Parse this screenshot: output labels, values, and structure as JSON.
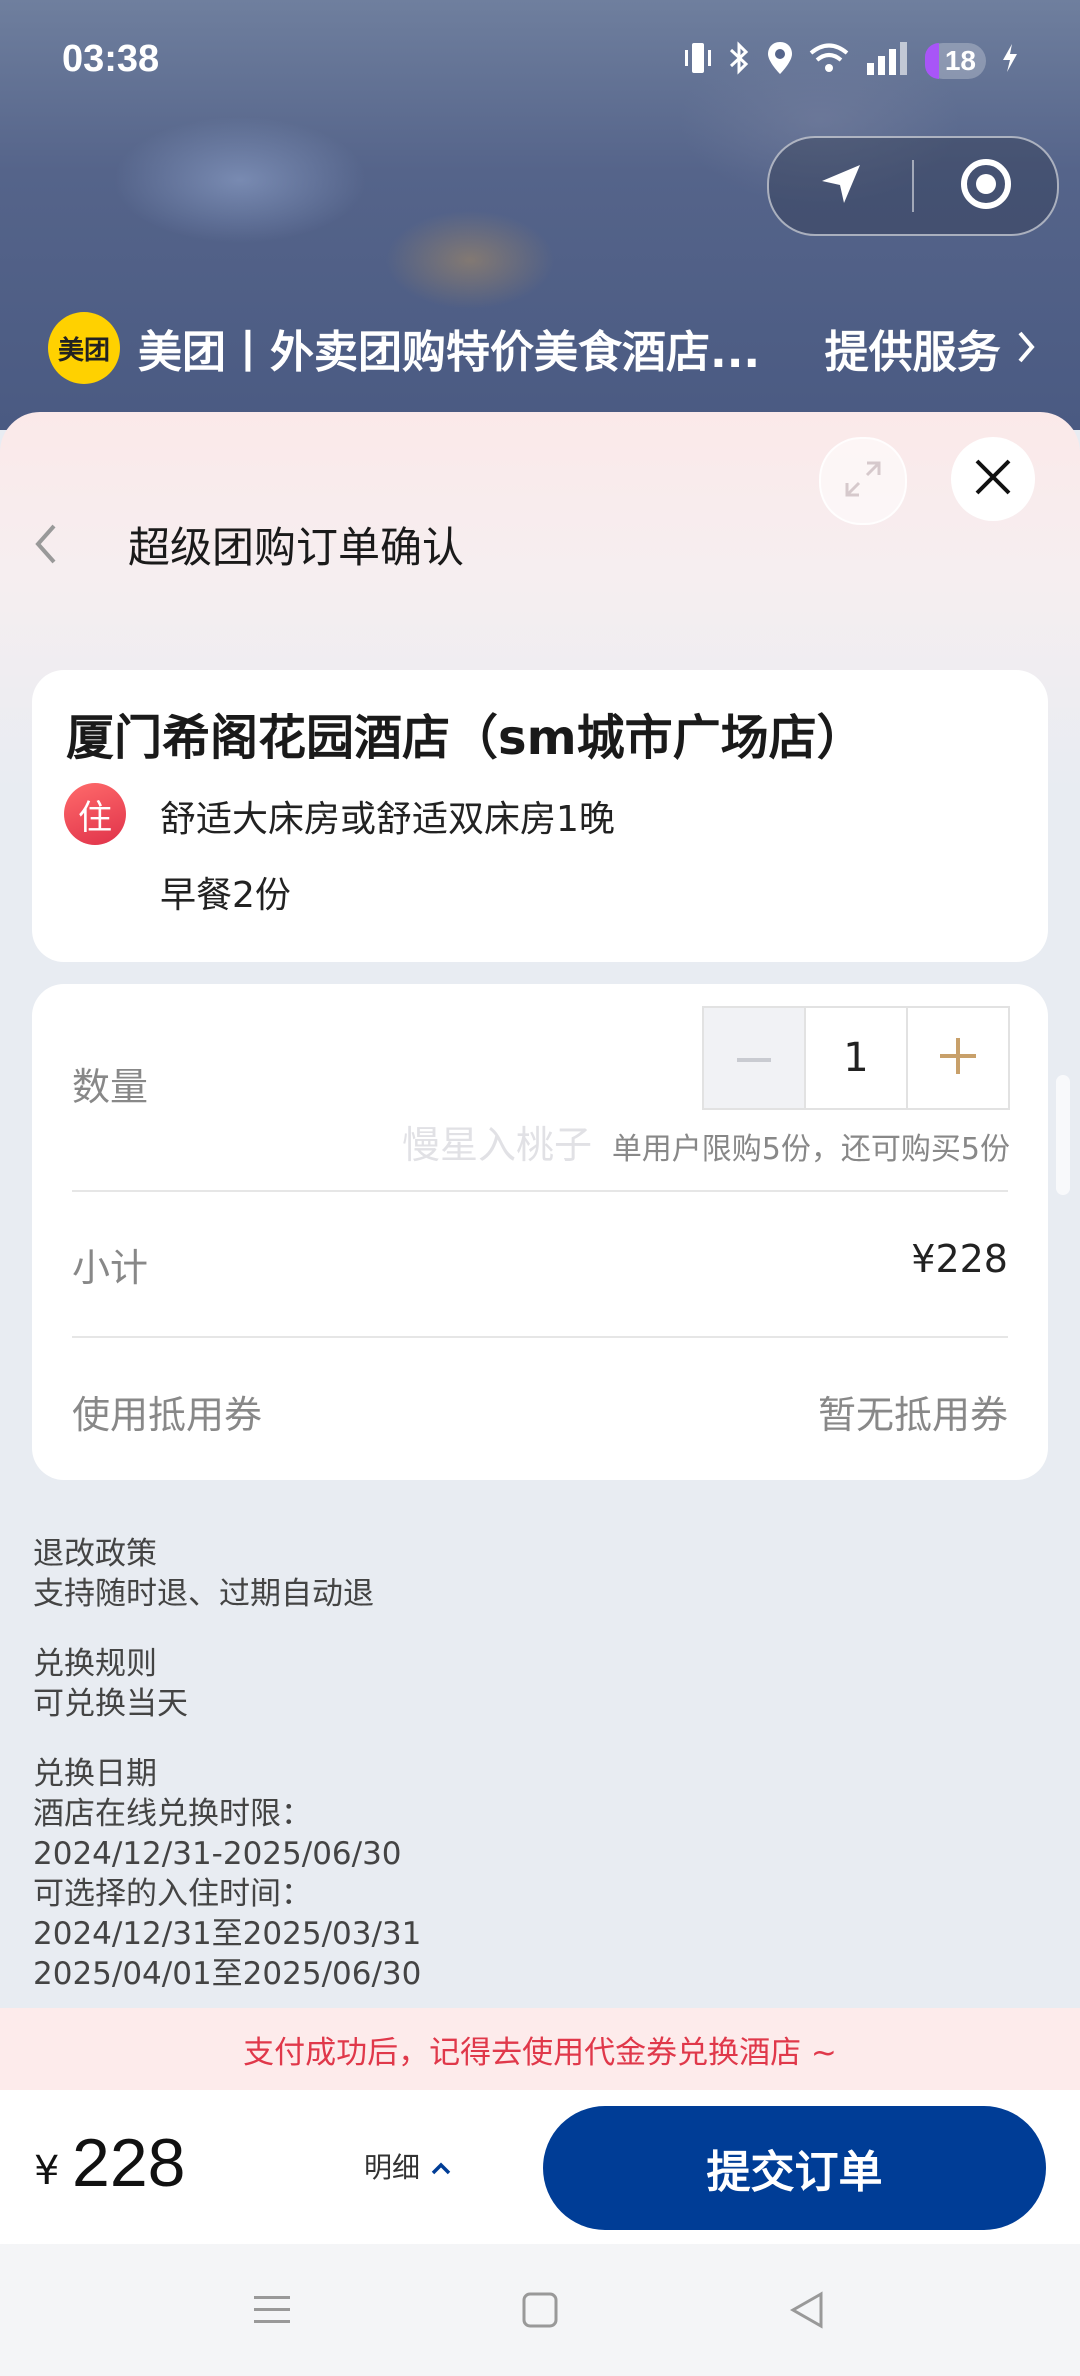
{
  "status_bar": {
    "time": "03:38",
    "battery": "18"
  },
  "miniprogram": {
    "logo_text": "美团",
    "name": "美团丨外卖团购特价美食酒店...",
    "service_link": "提供服务"
  },
  "header": {
    "title": "超级团购订单确认"
  },
  "hotel": {
    "name": "厦门希阁花园酒店（sm城市广场店）",
    "badge": "住",
    "room": "舒适大床房或舒适双床房1晚",
    "breakfast": "早餐2份"
  },
  "order": {
    "quantity_label": "数量",
    "quantity_value": "1",
    "limit_text": "单用户限购5份，还可购买5份",
    "watermark": "慢星入桃子",
    "subtotal_label": "小计",
    "subtotal_value": "¥228",
    "coupon_label": "使用抵用券",
    "coupon_value": "暂无抵用券"
  },
  "policies": {
    "refund_title": "退改政策",
    "refund_text": "支持随时退、过期自动退",
    "exchange_title": "兑换规则",
    "exchange_text": "可兑换当天",
    "date_title": "兑换日期",
    "date_line1": "酒店在线兑换时限：",
    "date_line2": "2024/12/31-2025/06/30",
    "date_line3": "可选择的入住时间：",
    "date_line4": "2024/12/31至2025/03/31",
    "date_line5": "2025/04/01至2025/06/30"
  },
  "notice": "支付成功后，记得去使用代金券兑换酒店 ~",
  "footer": {
    "currency": "¥",
    "price": "228",
    "detail_label": "明细",
    "submit_label": "提交订单"
  },
  "colors": {
    "primary": "#003d96",
    "accent": "#c8a06a",
    "notice_text": "#e0384a",
    "badge": "#e8404f"
  },
  "icons": [
    "vibrate-icon",
    "bluetooth-icon",
    "location-icon",
    "wifi-icon",
    "signal-icon",
    "charging-icon",
    "navigate-arrow-icon",
    "target-icon",
    "expand-icon",
    "close-icon",
    "back-icon",
    "minus-icon",
    "plus-icon",
    "chevron-up-icon",
    "menu-icon",
    "home-icon",
    "back-triangle-icon"
  ]
}
